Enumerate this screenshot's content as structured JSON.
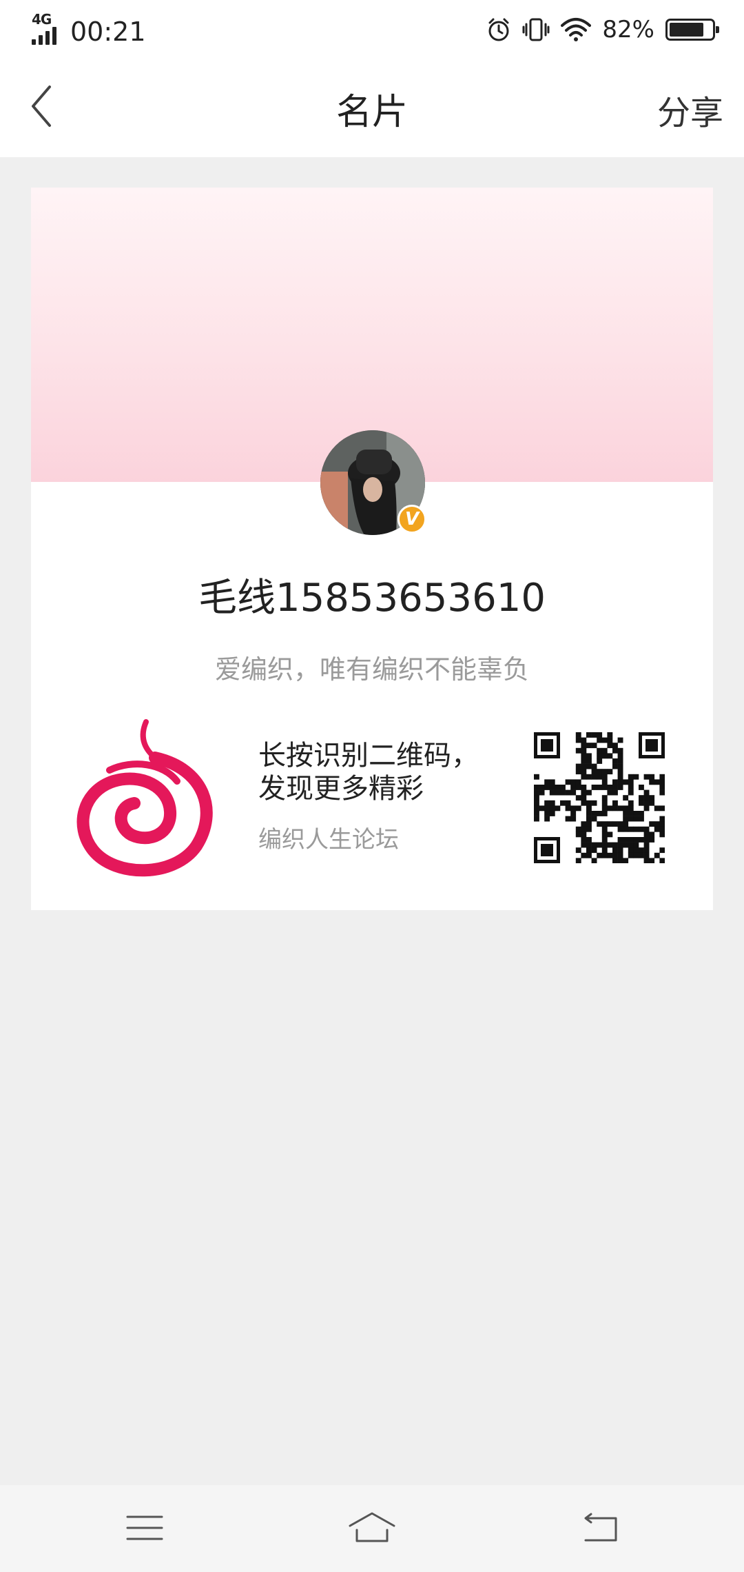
{
  "status_bar": {
    "network": "4G",
    "time": "00:21",
    "battery_percent": "82%",
    "battery_level": 0.82,
    "icons": [
      "signal-icon",
      "alarm-icon",
      "vibrate-icon",
      "wifi-icon",
      "battery-icon"
    ]
  },
  "nav": {
    "title": "名片",
    "share_label": "分享",
    "back_icon": "chevron-left-icon"
  },
  "profile": {
    "name": "毛线15853653610",
    "motto": "爱编织，唯有编织不能辜负",
    "badge_text": "V",
    "badge_color": "#f2a41f"
  },
  "qr_section": {
    "line1": "长按识别二维码，",
    "line2": "发现更多精彩",
    "site_name": "编织人生论坛",
    "logo_color": "#e4185a"
  },
  "colors": {
    "banner_top": "#fff4f6",
    "banner_bottom": "#fbd3dc",
    "page_bg": "#efefef"
  },
  "bottom_nav": {
    "icons": [
      "menu-icon",
      "home-icon",
      "return-icon"
    ]
  }
}
